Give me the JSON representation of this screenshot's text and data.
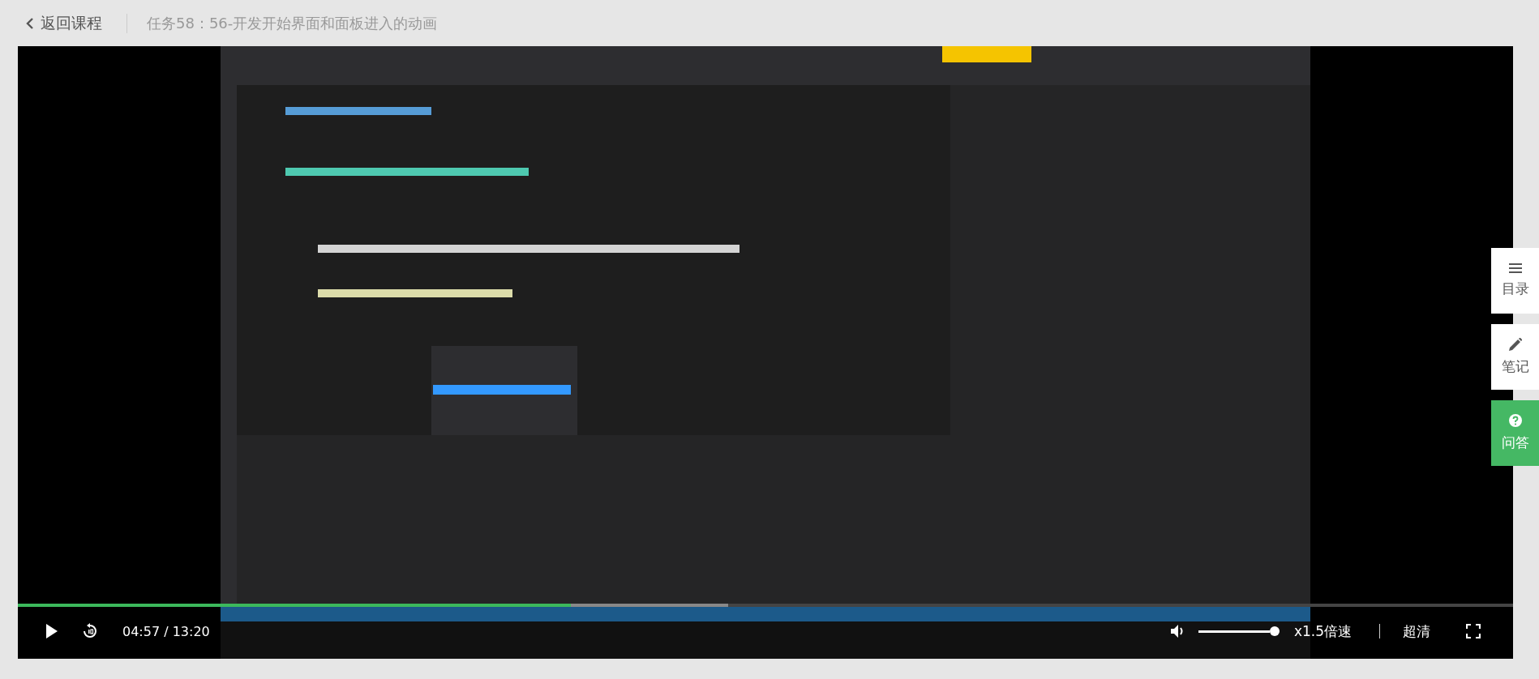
{
  "header": {
    "back_link": "返回课程",
    "title": "任务58：56-开发开始界面和面板进入的动画"
  },
  "player": {
    "progress": {
      "level": 0.37
    },
    "buffer": {
      "level": 0.475
    },
    "time": "04:57 / 13:20",
    "volume": {
      "level": 1
    },
    "speed": "x1.5倍速",
    "quality": "超清"
  },
  "side_menu": [
    {
      "label": "目录",
      "kind": "contents",
      "selected": false
    },
    {
      "label": "笔记",
      "kind": "notes",
      "selected": false
    },
    {
      "label": "问答",
      "kind": "qa",
      "selected": true
    }
  ]
}
